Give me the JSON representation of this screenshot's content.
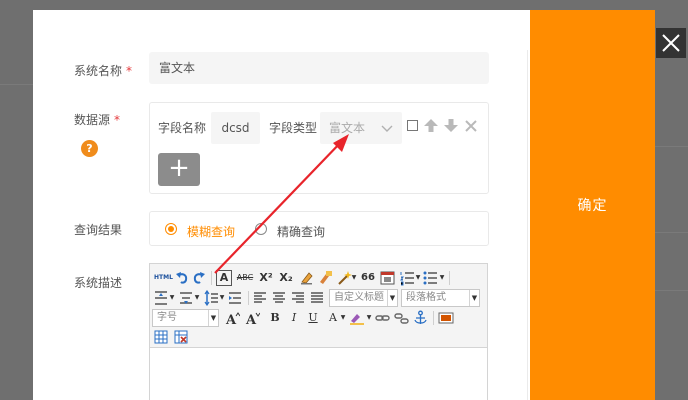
{
  "form": {
    "system_name": {
      "label": "系统名称",
      "required": "*",
      "value": "富文本"
    },
    "datasource": {
      "label": "数据源",
      "required": "*",
      "help": "?",
      "field_name_label": "字段名称",
      "field_name_value": "dcsd",
      "field_type_label": "字段类型",
      "field_type_value": "富文本",
      "add_label": "+"
    },
    "query_result": {
      "label": "查询结果",
      "options": [
        {
          "label": "模糊查询",
          "selected": true
        },
        {
          "label": "精确查询",
          "selected": false
        }
      ]
    },
    "description": {
      "label": "系统描述",
      "toolbar": {
        "html_label": "HTML",
        "font_icon_label": "A",
        "strike_label": "ABC",
        "sup_label": "X²",
        "sub_label": "X₂",
        "quote_label": "66",
        "custom_title": "自定义标题",
        "paragraph_format": "段落格式",
        "font_size": "字号",
        "bold": "B",
        "italic": "I",
        "underline": "U",
        "font_color": "A"
      }
    }
  },
  "confirm_label": "确定",
  "colors": {
    "accent": "#ff8c00",
    "help": "#f08c1c",
    "annotation_arrow": "#e8242b",
    "close_bg": "#333333"
  }
}
